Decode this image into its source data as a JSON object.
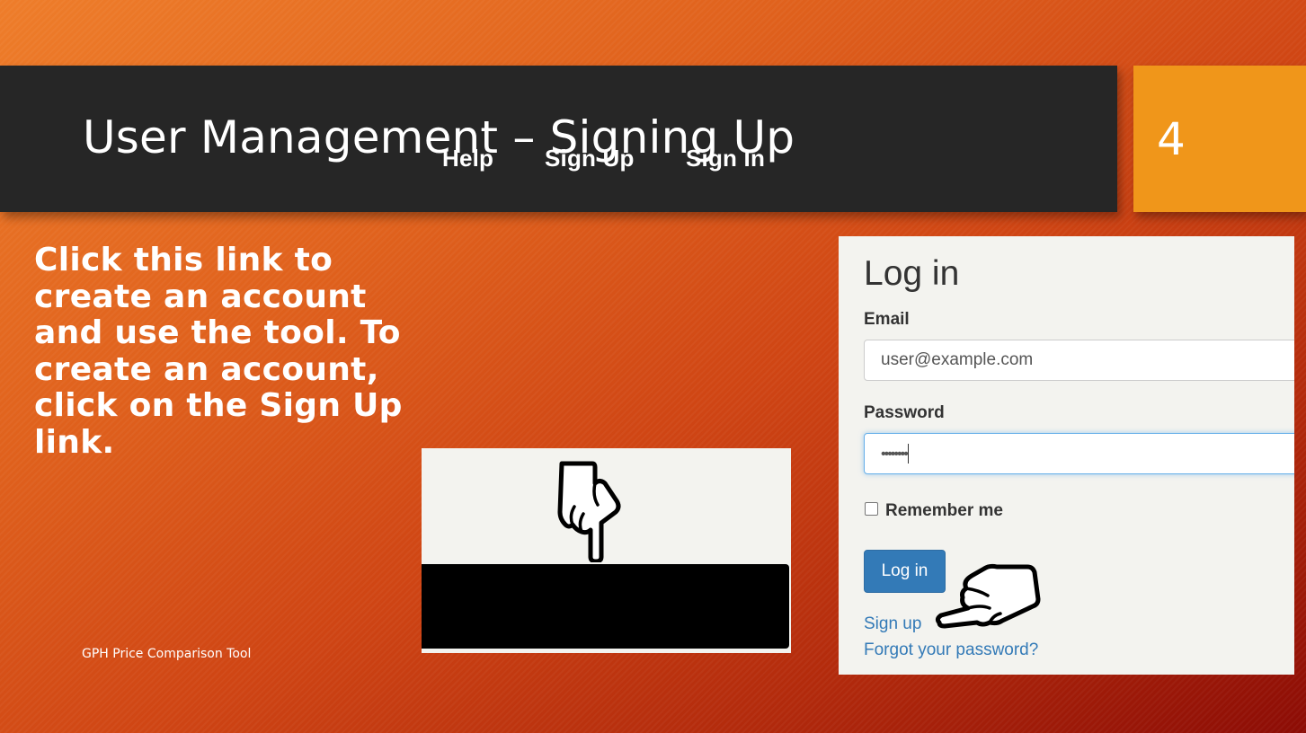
{
  "slide": {
    "title": "User Management – Signing Up",
    "number": "4",
    "body": "Click this link to create an account and use the tool. To create an account, click on the Sign Up link.",
    "footer": "GPH Price Comparison Tool"
  },
  "nav_screenshot": {
    "links": [
      "Help",
      "Sign Up",
      "Sign In"
    ],
    "pointer_icon": "hand-pointing-down-icon"
  },
  "login_screenshot": {
    "heading": "Log in",
    "email_label": "Email",
    "email_value": "user@example.com",
    "password_label": "Password",
    "password_value": "••••••••",
    "remember_label": "Remember me",
    "submit_label": "Log in",
    "signup_link": "Sign up",
    "forgot_link": "Forgot your password?",
    "pointer_icon": "hand-pointing-left-icon"
  },
  "colors": {
    "title_bar": "#262626",
    "number_box": "#f0961a",
    "button": "#337ab7",
    "link": "#337ab7"
  }
}
